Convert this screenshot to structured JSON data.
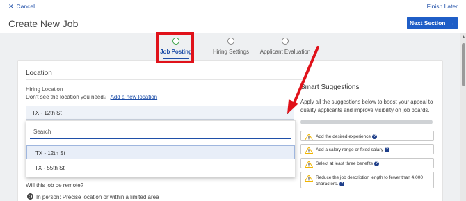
{
  "topbar": {
    "cancel_label": "Cancel",
    "finish_label": "Finish Later"
  },
  "header": {
    "title": "Create New Job",
    "next_label": "Next Section"
  },
  "steps": [
    {
      "label": "Job Posting",
      "state": "active"
    },
    {
      "label": "Hiring Settings",
      "state": "upcoming"
    },
    {
      "label": "Applicant Evaluation",
      "state": "upcoming"
    }
  ],
  "location": {
    "section_title": "Location",
    "field_label": "Hiring Location",
    "helper_text": "Don't see the location you need?",
    "add_link": "Add a new location",
    "selected_value": "TX - 12th St",
    "search_placeholder": "Search",
    "options": [
      "TX - 12th St",
      "TX - 55th St"
    ]
  },
  "remote": {
    "question": "Will this job be remote?",
    "option_in_person": "In person: Precise location or within a limited area"
  },
  "suggestions": {
    "title": "Smart Suggestions",
    "description": "Apply all the suggestions below to boost your appeal to quality applicants and improve visibility on job boards.",
    "items": [
      "Add the desired experience",
      "Add a salary range or fixed salary",
      "Select at least three benefits",
      "Reduce the job description length to fewer than 4,000 characters."
    ]
  },
  "colors": {
    "accent": "#1f5ec7",
    "annotation": "#e0121a",
    "active_step": "#3ea34a",
    "warning": "#f0b400"
  }
}
